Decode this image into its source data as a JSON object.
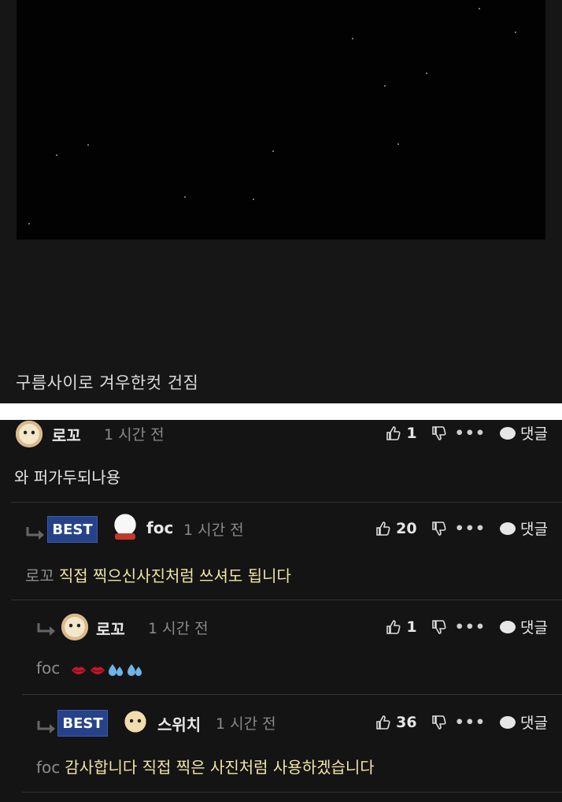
{
  "post": {
    "caption": "구름사이로 겨우한컷 건짐"
  },
  "comments": [
    {
      "author": "로꼬",
      "time": "1 시간 전",
      "likes": "1",
      "reply_label": "댓글",
      "text": "와 퍼가두되나용"
    },
    {
      "badge": "BEST",
      "author": "foc",
      "time": "1 시간 전",
      "likes": "20",
      "reply_label": "댓글",
      "mention": "로꼬",
      "text": "직접 찍으신사진처럼 쓰셔도 됩니다"
    },
    {
      "author": "로꼬",
      "time": "1 시간 전",
      "likes": "1",
      "reply_label": "댓글",
      "mention": "foc",
      "emojis": [
        "kiss-mark",
        "kiss-mark",
        "sweat-droplets",
        "sweat-droplets"
      ]
    },
    {
      "badge": "BEST",
      "author": "스위치",
      "time": "1 시간 전",
      "likes": "36",
      "reply_label": "댓글",
      "mention": "foc",
      "text": "감사합니다 직접 찍은 사진처럼 사용하겠습니다"
    }
  ],
  "more_label": "•••"
}
